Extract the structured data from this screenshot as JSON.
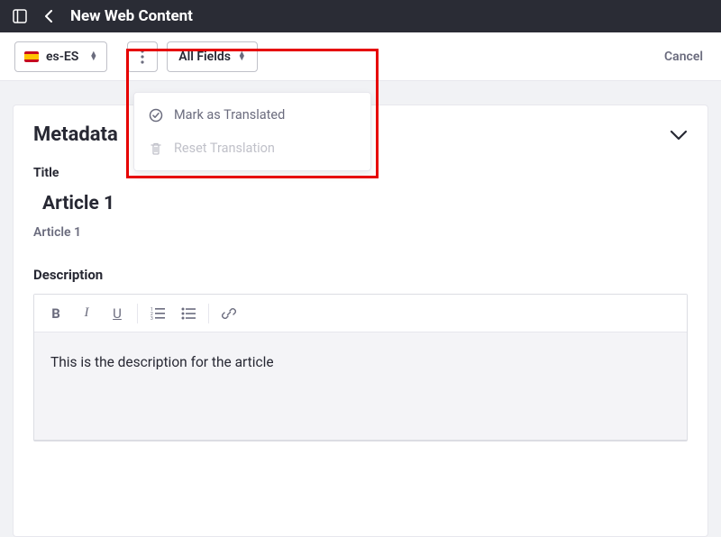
{
  "header": {
    "title": "New Web Content"
  },
  "toolbar": {
    "locale": "es-ES",
    "fields_label": "All Fields",
    "cancel_label": "Cancel"
  },
  "dropdown": {
    "mark_translated": "Mark as Translated",
    "reset_translation": "Reset Translation"
  },
  "panel": {
    "heading": "Metadata"
  },
  "title": {
    "label": "Title",
    "value_primary": "Article 1",
    "value_secondary": "Article 1"
  },
  "description": {
    "label": "Description",
    "content": "This is the description for the article"
  }
}
